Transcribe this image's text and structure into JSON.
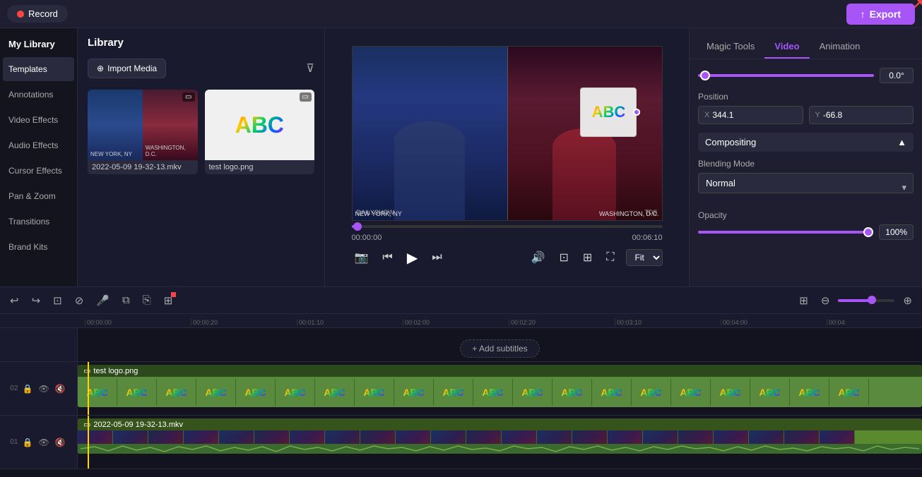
{
  "topBar": {
    "recordLabel": "Record",
    "exportLabel": "Export"
  },
  "sidebar": {
    "myLibrary": "My Library",
    "items": [
      {
        "label": "Templates",
        "active": false
      },
      {
        "label": "Annotations",
        "active": false
      },
      {
        "label": "Video Effects",
        "active": false
      },
      {
        "label": "Audio Effects",
        "active": false
      },
      {
        "label": "Cursor Effects",
        "active": false
      },
      {
        "label": "Pan & Zoom",
        "active": false
      },
      {
        "label": "Transitions",
        "active": false
      },
      {
        "label": "Brand Kits",
        "active": false
      }
    ]
  },
  "library": {
    "title": "Library",
    "importLabel": "Import Media",
    "media": [
      {
        "name": "2022-05-09 19-32-13.mkv",
        "type": "video"
      },
      {
        "name": "test logo.png",
        "type": "image"
      }
    ]
  },
  "preview": {
    "leftLabel": "NEW YORK, NY",
    "rightLabel": "WASHINGTON, D.C.",
    "watermark": "DAILYSHOW",
    "tdsLabel": "TDS",
    "currentTime": "00:00:00",
    "duration": "00:06:10",
    "fitOption": "Fit"
  },
  "rightPanel": {
    "tabs": [
      {
        "label": "Magic Tools",
        "active": false
      },
      {
        "label": "Video",
        "active": true
      },
      {
        "label": "Animation",
        "active": false
      }
    ],
    "rotation": "0.0°",
    "position": {
      "label": "Position",
      "x": {
        "label": "X",
        "value": "344.1"
      },
      "y": {
        "label": "Y",
        "value": "-66.8"
      }
    },
    "compositing": "Compositing",
    "blendingMode": {
      "label": "Blending Mode",
      "value": "Normal"
    },
    "opacity": {
      "label": "Opacity",
      "value": "100%"
    }
  },
  "timeline": {
    "addSubtitlesLabel": "+ Add subtitles",
    "tracks": [
      {
        "num": "02",
        "clipLabel": "test logo.png",
        "type": "image"
      },
      {
        "num": "01",
        "clipLabel": "2022-05-09 19-32-13.mkv",
        "type": "video"
      }
    ],
    "rulerMarks": [
      "00:00:00",
      "00:00:20",
      "00:01:10",
      "00:02:00",
      "00:02:20",
      "00:03:10",
      "00:04:00",
      "00:04:"
    ]
  },
  "icons": {
    "record": "⏺",
    "export": "⬆",
    "play": "▶",
    "pause": "⏸",
    "skipBack": "⏮",
    "skipForward": "⏭",
    "volume": "🔊",
    "fullscreen": "⛶",
    "camera": "📷",
    "lock": "🔒",
    "eye": "👁",
    "audio_mute": "🔇",
    "undo": "↩",
    "redo": "↪",
    "crop": "⊡",
    "filter_funnel": "⊽"
  }
}
